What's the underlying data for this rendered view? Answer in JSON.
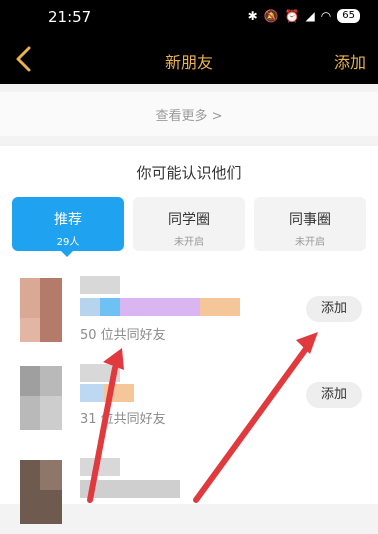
{
  "status_bar": {
    "time": "21:57",
    "battery": "65"
  },
  "nav": {
    "title": "新朋友",
    "add_label": "添加"
  },
  "more": {
    "label": "查看更多 >"
  },
  "section": {
    "title": "你可能认识他们",
    "tabs": [
      {
        "label": "推荐",
        "sub": "29人",
        "active": true
      },
      {
        "label": "同学圈",
        "sub": "未开启",
        "active": false
      },
      {
        "label": "同事圈",
        "sub": "未开启",
        "active": false
      }
    ]
  },
  "rows": [
    {
      "mutual": "50 位共同好友",
      "add_label": "添加"
    },
    {
      "mutual": "31 位共同好友",
      "add_label": "添加"
    }
  ],
  "colors": {
    "accent": "#e9b24f",
    "tab_active": "#1fa2f0",
    "arrow": "#e0393e"
  }
}
